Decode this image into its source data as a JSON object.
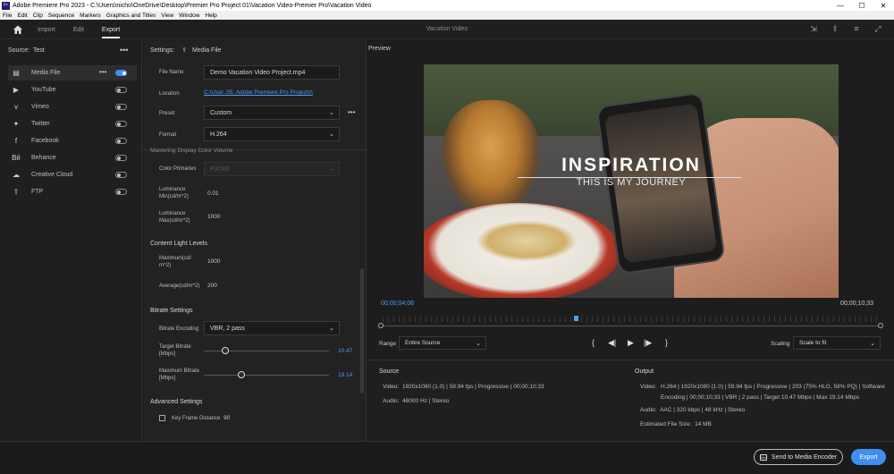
{
  "titlebar": {
    "app_title": "Adobe Premiere Pro 2023 - C:\\Users\\nicho\\OneDrive\\Desktop\\Premier Pro Project 01\\Vacation Video-Premier Pro\\Vacation Video",
    "minimize": "—",
    "maximize": "☐",
    "close": "✕"
  },
  "menubar": {
    "items": [
      "File",
      "Edit",
      "Clip",
      "Sequence",
      "Markers",
      "Graphics and Titles",
      "View",
      "Window",
      "Help"
    ]
  },
  "header": {
    "tabs": [
      "Import",
      "Edit",
      "Export"
    ],
    "active_tab": "Export",
    "sequence_title": "Vacation Video"
  },
  "source": {
    "label": "Source:",
    "name": "Test"
  },
  "destinations": [
    {
      "label": "Media File",
      "icon": "file-icon",
      "on": true
    },
    {
      "label": "YouTube",
      "icon": "youtube-icon",
      "on": false
    },
    {
      "label": "Vimeo",
      "icon": "vimeo-icon",
      "on": false
    },
    {
      "label": "Twitter",
      "icon": "twitter-icon",
      "on": false
    },
    {
      "label": "Facebook",
      "icon": "facebook-icon",
      "on": false
    },
    {
      "label": "Behance",
      "icon": "behance-icon",
      "on": false
    },
    {
      "label": "Creative Cloud",
      "icon": "creative-cloud-icon",
      "on": false
    },
    {
      "label": "FTP",
      "icon": "ftp-icon",
      "on": false
    }
  ],
  "settings": {
    "header_label": "Settings:",
    "header_target": "Media File",
    "file_name_label": "File Name",
    "file_name_value": "Demo Vacation Video Project.mp4",
    "location_label": "Location",
    "location_value": "C:\\User..05. Adobe Premiere Pro Projects\\",
    "preset_label": "Preset",
    "preset_value": "Custom",
    "format_label": "Format",
    "format_value": "H.264",
    "cutoff_heading": "Mastering Display Color Volume",
    "color_primaries_label": "Color Primaries",
    "color_primaries_value": "P3D65",
    "lum_min_label_1": "Luminance",
    "lum_min_label_2": "Min(cd/m^2)",
    "lum_min_value": "0.01",
    "lum_max_label_1": "Luminance",
    "lum_max_label_2": "Max(cd/m^2)",
    "lum_max_value": "1000",
    "content_light_heading": "Content Light Levels",
    "max_label_1": "Maximum(cd/",
    "max_label_2": "m^2)",
    "max_value": "1000",
    "avg_label": "Average(cd/m^2)",
    "avg_value": "200",
    "bitrate_heading": "Bitrate Settings",
    "bitrate_encoding_label": "Bitrate Encoding",
    "bitrate_encoding_value": "VBR, 2 pass",
    "target_bitrate_label_1": "Target Bitrate",
    "target_bitrate_label_2": "[Mbps]",
    "target_bitrate_value": "10.47",
    "target_bitrate_fraction": 0.17,
    "max_bitrate_label_1": "Maximum Bitrate",
    "max_bitrate_label_2": "[Mbps]",
    "max_bitrate_value": "19.14",
    "max_bitrate_fraction": 0.3,
    "advanced_heading": "Advanced Settings",
    "key_frame_label": "Key Frame Distance",
    "key_frame_value": "90"
  },
  "preview": {
    "label": "Preview",
    "video_title": "INSPIRATION",
    "video_subtitle": "THIS IS MY JOURNEY",
    "current_time": "00;00;04;08",
    "end_time": "00;00;10;33",
    "playhead_fraction": 0.39,
    "range_label": "Range",
    "range_value": "Entire Source",
    "scaling_label": "Scaling",
    "scaling_value": "Scale to fit"
  },
  "source_info": {
    "heading": "Source",
    "video_label": "Video:",
    "video_value": "1920x1080 (1.0)  |  59.94 fps  |  Progressive  |  00;00;10;33",
    "audio_label": "Audio:",
    "audio_value": "48000 Hz  |  Stereo"
  },
  "output_info": {
    "heading": "Output",
    "video_label": "Video:",
    "video_line1": "H.264  |  1920x1080 (1.0)  |  59.94 fps  |  Progressive  |  203 (75% HLG, 58% PQ)  |  Software",
    "video_line2": "Encoding  |  00;00;10;33  |  VBR  |  2 pass  |  Target 10.47 Mbps  |  Max 19.14 Mbps",
    "audio_label": "Audio:",
    "audio_value": "AAC  |  320 kbps  |  48 kHz  |  Stereo",
    "size_label": "Estimated File Size:",
    "size_value": "14 MB"
  },
  "footer": {
    "send_label": "Send to Media Encoder",
    "export_label": "Export"
  },
  "colors": {
    "accent": "#3f8ef0",
    "timecode": "#4e9cf5"
  }
}
